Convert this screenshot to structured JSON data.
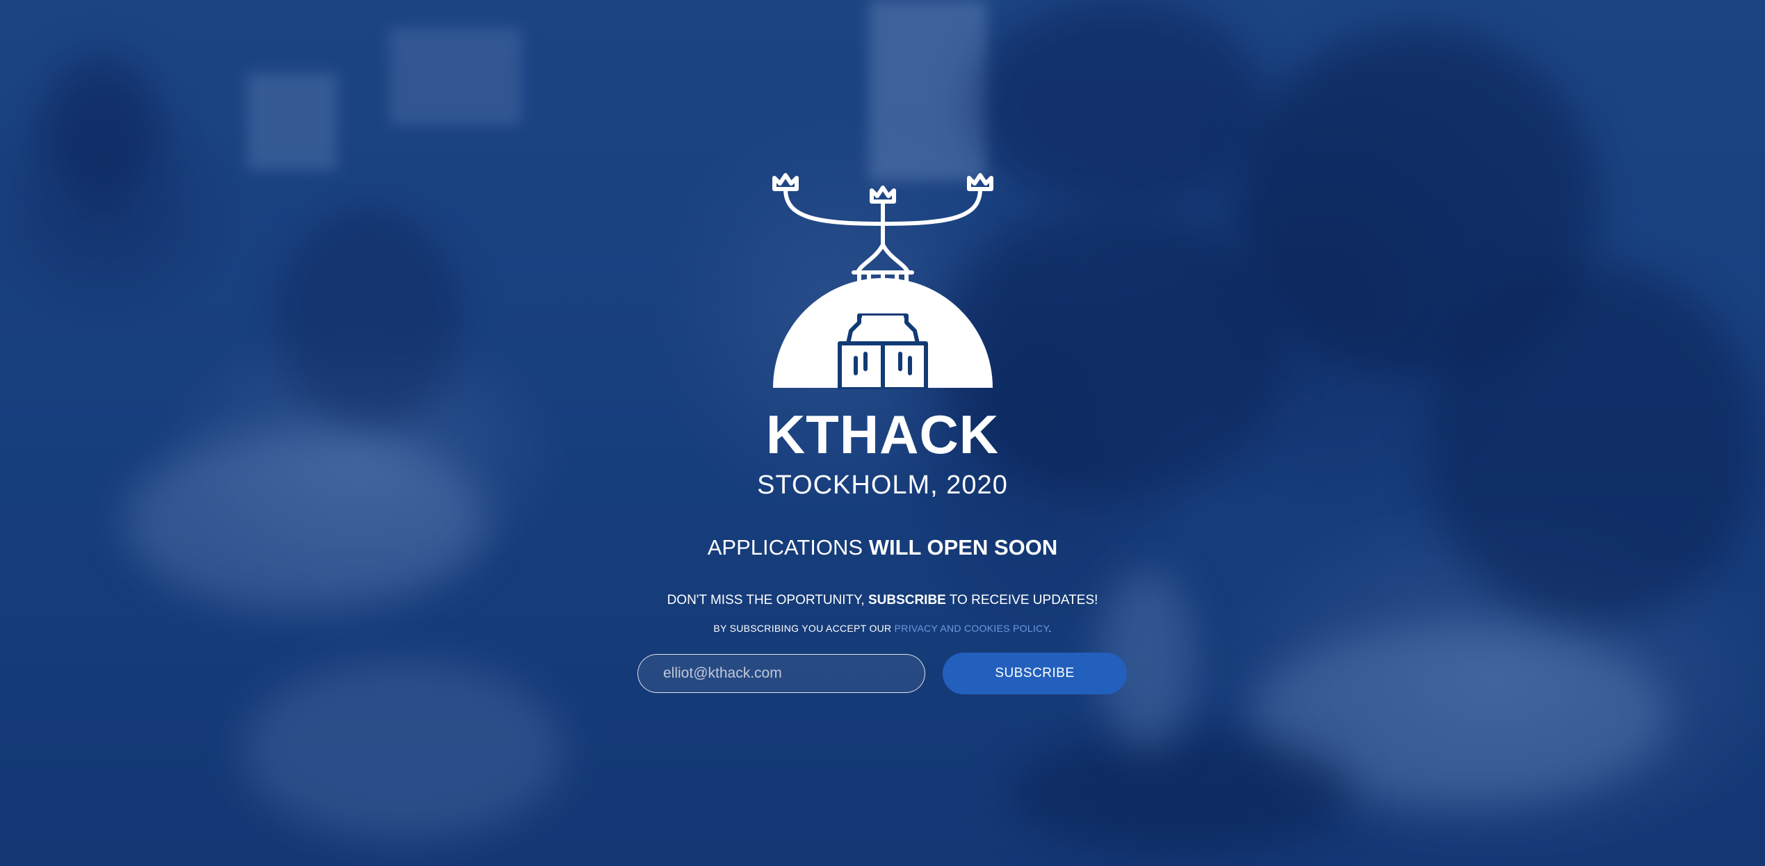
{
  "brand": {
    "title": "KTHACK",
    "subtitle": "STOCKHOLM, 2020",
    "logo_icon": "stockholm-city-hall-tower-icon"
  },
  "announcement": {
    "prefix": "APPLICATIONS ",
    "emphasis": "WILL OPEN SOON"
  },
  "promo": {
    "before": "DON'T MISS THE OPORTUNITY, ",
    "emphasis": "SUBSCRIBE",
    "after": " TO RECEIVE UPDATES!"
  },
  "consent": {
    "before": "BY SUBSCRIBING YOU ACCEPT OUR ",
    "link": "PRIVACY AND COOKIES POLICY",
    "after": "."
  },
  "subscribe_form": {
    "email_placeholder": "elliot@kthack.com",
    "button_label": "SUBSCRIBE"
  },
  "colors": {
    "background": "#1d4686",
    "button": "#2360bd",
    "link": "#6b9be0",
    "text": "#ffffff"
  }
}
